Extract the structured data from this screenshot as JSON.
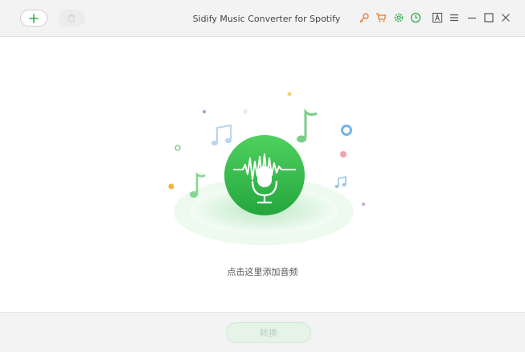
{
  "app": {
    "title": "Sidify Music Converter for Spotify"
  },
  "toolbar": {
    "add": {
      "icon": "plus-icon"
    },
    "delete": {
      "icon": "trash-icon",
      "enabled": false
    }
  },
  "title_icons": [
    {
      "name": "key-icon",
      "color": "#e8762b"
    },
    {
      "name": "cart-icon",
      "color": "#e8762b"
    },
    {
      "name": "gear-icon",
      "color": "#2eae4b"
    },
    {
      "name": "clock-icon",
      "color": "#2eae4b"
    },
    {
      "name": "language-icon",
      "color": "#555555"
    },
    {
      "name": "menu-icon",
      "color": "#555555"
    },
    {
      "name": "minimize-icon",
      "color": "#555555"
    },
    {
      "name": "maximize-icon",
      "color": "#555555"
    },
    {
      "name": "close-icon",
      "color": "#555555"
    }
  ],
  "main": {
    "hint": "点击这里添加音频",
    "illustration": {
      "icon": "microphone-waveform-icon",
      "accent": "#2fb34a"
    }
  },
  "footer": {
    "convert_label": "转换",
    "convert_enabled": false
  },
  "colors": {
    "accent_green": "#2fb34a",
    "accent_orange": "#e8762b",
    "bar_bg": "#f3f3f3"
  }
}
